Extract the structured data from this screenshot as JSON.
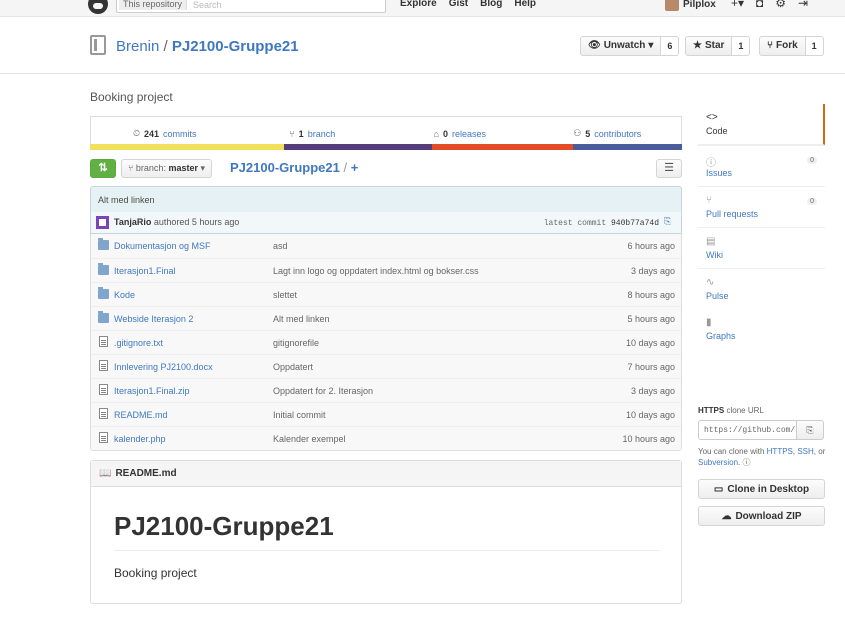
{
  "header": {
    "search_scope": "This repository",
    "search_placeholder": "Search",
    "nav": [
      "Explore",
      "Gist",
      "Blog",
      "Help"
    ],
    "username": "Pilplox",
    "icons": [
      "plus-icon",
      "notifications-icon",
      "settings-icon",
      "sign-out-icon"
    ]
  },
  "repo": {
    "owner": "Brenin",
    "separator": "/",
    "name": "PJ2100-Gruppe21",
    "description": "Booking project",
    "watch_label": "Unwatch",
    "watch_count": "6",
    "star_label": "Star",
    "star_count": "1",
    "fork_label": "Fork",
    "fork_count": "1"
  },
  "summary": {
    "commits_num": "241",
    "commits_label": "commits",
    "branches_num": "1",
    "branches_label": "branch",
    "releases_num": "0",
    "releases_label": "releases",
    "contributors_num": "5",
    "contributors_label": "contributors",
    "language_colors": [
      "#f1e05a",
      "#563d7c",
      "#e34c26",
      "#4a5c9c"
    ],
    "language_shares": [
      0.328,
      0.25,
      0.238,
      0.184
    ]
  },
  "filenav": {
    "branch_prefix": "branch:",
    "branch_name": "master",
    "crumb_repo": "PJ2100-Gruppe21",
    "crumb_sep": "/",
    "crumb_plus": "+"
  },
  "commit": {
    "message": "Alt med linken",
    "author": "TanjaRio",
    "authored": "authored 5 hours ago",
    "latest_label": "latest commit",
    "sha": "940b77a74d"
  },
  "files": [
    {
      "type": "dir",
      "name": "Dokumentasjon og MSF",
      "message": "asd",
      "age": "6 hours ago"
    },
    {
      "type": "dir",
      "name": "Iterasjon1.Final",
      "message": "Lagt inn logo og oppdatert index.html og bokser.css",
      "age": "3 days ago"
    },
    {
      "type": "dir",
      "name": "Kode",
      "message": "slettet",
      "age": "8 hours ago"
    },
    {
      "type": "dir",
      "name": "Webside Iterasjon 2",
      "message": "Alt med linken",
      "age": "5 hours ago"
    },
    {
      "type": "file",
      "name": ".gitignore.txt",
      "message": "gitignorefile",
      "age": "10 days ago"
    },
    {
      "type": "file",
      "name": "Innlevering PJ2100.docx",
      "message": "Oppdatert",
      "age": "7 hours ago"
    },
    {
      "type": "file",
      "name": "Iterasjon1.Final.zip",
      "message": "Oppdatert for 2. Iterasjon",
      "age": "3 days ago"
    },
    {
      "type": "file",
      "name": "README.md",
      "message": "Initial commit",
      "age": "10 days ago"
    },
    {
      "type": "file",
      "name": "kalender.php",
      "message": "Kalender exempel",
      "age": "10 hours ago"
    }
  ],
  "readme": {
    "filename": "README.md",
    "heading": "PJ2100-Gruppe21",
    "body": "Booking project"
  },
  "sidebar": {
    "items": [
      {
        "icon": "<>",
        "label": "Code",
        "badge": ""
      },
      {
        "icon": "ⓘ",
        "label": "Issues",
        "badge": "0"
      },
      {
        "icon": "⑂",
        "label": "Pull requests",
        "badge": "0"
      },
      {
        "icon": "▤",
        "label": "Wiki",
        "badge": ""
      },
      {
        "icon": "∿",
        "label": "Pulse",
        "badge": ""
      },
      {
        "icon": "▮",
        "label": "Graphs",
        "badge": ""
      }
    ],
    "clone_proto": "HTTPS",
    "clone_label": "clone URL",
    "clone_url": "https://github.com/",
    "clone_help_pre": "You can clone with",
    "clone_help_https": "HTTPS",
    "clone_help_ssh": "SSH",
    "clone_help_or": "or",
    "clone_help_svn": "Subversion",
    "desktop_label": "Clone in Desktop",
    "zip_label": "Download ZIP"
  }
}
